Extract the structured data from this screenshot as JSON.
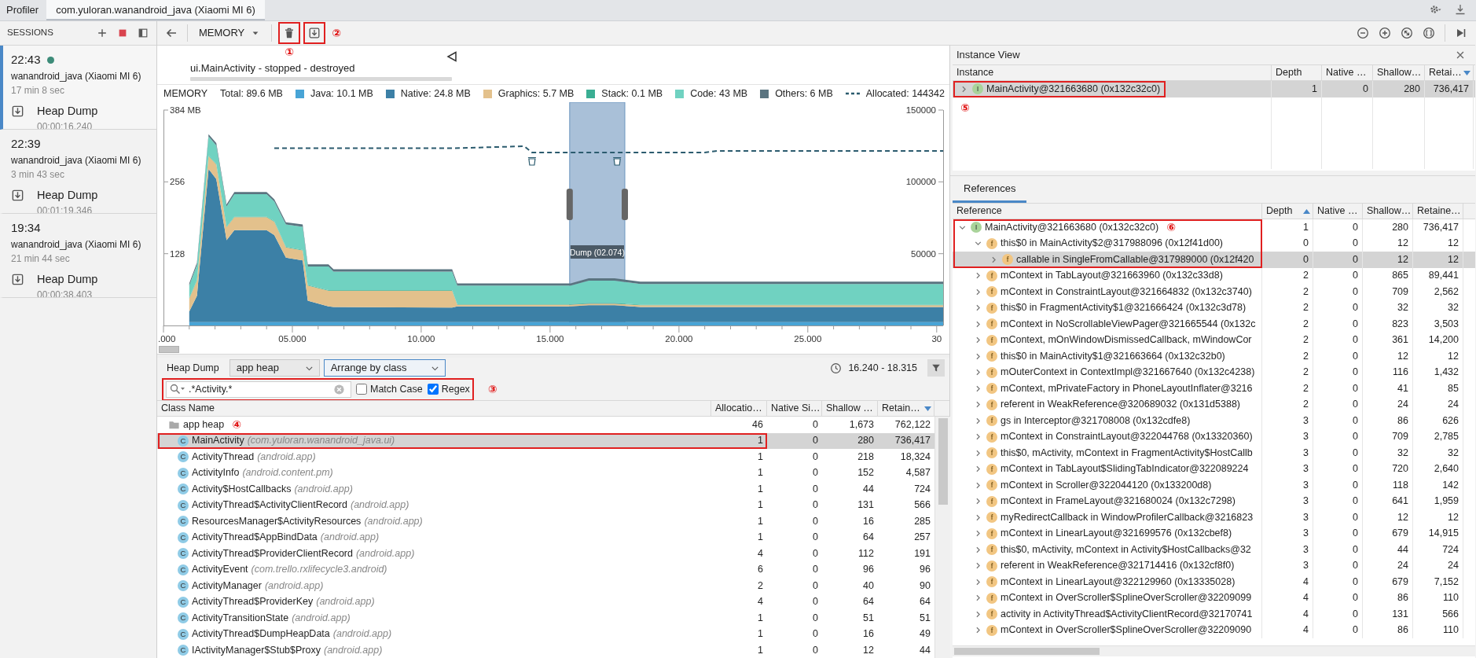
{
  "app_bar": {
    "title": "Profiler",
    "tabs": [
      {
        "label": "com.yuloran.wanandroid_java (Xiaomi MI 6)",
        "selected": true
      }
    ]
  },
  "sessions": {
    "title": "SESSIONS",
    "items": [
      {
        "time": "22:43",
        "live": true,
        "selected": true,
        "device": "wanandroid_java (Xiaomi MI 6)",
        "duration": "17 min 8 sec",
        "artifacts": [
          {
            "label": "Heap Dump",
            "time": "00:00:16.240"
          }
        ]
      },
      {
        "time": "22:39",
        "live": false,
        "selected": false,
        "device": "wanandroid_java (Xiaomi MI 6)",
        "duration": "3 min 43 sec",
        "artifacts": [
          {
            "label": "Heap Dump",
            "time": "00:01:19.346"
          }
        ]
      },
      {
        "time": "19:34",
        "live": false,
        "selected": false,
        "device": "wanandroid_java (Xiaomi MI 6)",
        "duration": "21 min 44 sec",
        "artifacts": [
          {
            "label": "Heap Dump",
            "time": "00:00:38.403"
          }
        ]
      }
    ]
  },
  "toolbar": {
    "profiler": "MEMORY",
    "actions": [
      {
        "kind": "delete",
        "highlighted": true,
        "note": "①"
      },
      {
        "kind": "export",
        "highlighted": true,
        "note": "②"
      }
    ]
  },
  "memory": {
    "event": {
      "label": "ui.MainActivity - stopped - destroyed"
    },
    "legend_title": "MEMORY",
    "total": "Total: 89.6 MB",
    "selection": {
      "label": "Dump (02.074)"
    },
    "chart_data": {
      "type": "area",
      "stacked": true,
      "xlim": [
        0,
        30.25
      ],
      "ylim": [
        0,
        384
      ],
      "x": [
        1.0,
        1.3,
        1.75,
        2.05,
        2.45,
        2.75,
        4.0,
        4.3,
        4.75,
        5.4,
        5.6,
        6.4,
        6.6,
        11.2,
        11.4,
        15.8,
        16.5,
        17.5,
        18.5,
        30.25
      ],
      "xticks": [
        {
          "value": 0,
          "label": ".000"
        },
        {
          "value": 5,
          "label": "05.000"
        },
        {
          "value": 10,
          "label": "10.000"
        },
        {
          "value": 15,
          "label": "15.000"
        },
        {
          "value": 20,
          "label": "20.000"
        },
        {
          "value": 25,
          "label": "25.000"
        },
        {
          "value": 30,
          "label": "30"
        }
      ],
      "yticks": [
        {
          "value": 128,
          "label": "128"
        },
        {
          "value": 256,
          "label": "256"
        },
        {
          "value": 384,
          "label": "384 MB"
        }
      ],
      "series": [
        {
          "name": "Java: 10.1 MB",
          "color": "#48a4d6",
          "values": [
            6,
            6,
            6,
            6,
            6,
            6,
            6,
            6,
            6,
            6,
            6,
            6,
            6,
            6,
            6,
            6,
            6,
            6,
            6,
            6
          ]
        },
        {
          "name": "Native: 24.8 MB",
          "color": "#3c80a6",
          "values": [
            19,
            47,
            273,
            255,
            146,
            164,
            164,
            155,
            115,
            110,
            38,
            28,
            27,
            26,
            28,
            28,
            30,
            30,
            27,
            27
          ]
        },
        {
          "name": "Graphics: 5.7 MB",
          "color": "#e3c18c",
          "values": [
            23,
            27,
            23,
            26,
            23,
            23,
            23,
            24,
            18,
            18,
            27,
            28,
            29,
            30,
            3,
            3,
            3,
            3,
            3,
            3
          ]
        },
        {
          "name": "Stack: 0.1 MB",
          "color": "#3aae93",
          "values": [
            1,
            1,
            1,
            1,
            1,
            1,
            1,
            1,
            1,
            1,
            1,
            1,
            1,
            1,
            1,
            1,
            1,
            1,
            1,
            1
          ]
        },
        {
          "name": "Code: 43 MB",
          "color": "#70d2c1",
          "values": [
            22,
            27,
            34,
            33,
            36,
            40,
            40,
            35,
            40,
            41,
            33,
            42,
            33,
            33,
            33,
            33,
            40,
            40,
            37,
            37
          ]
        },
        {
          "name": "Others: 6 MB",
          "color": "#5a7480",
          "values": [
            4,
            4,
            4,
            4,
            4,
            4,
            4,
            4,
            4,
            4,
            4,
            4,
            4,
            4,
            4,
            4,
            4,
            4,
            4,
            4
          ]
        }
      ]
    },
    "allocations": {
      "chart_data": {
        "type": "line",
        "xlim": [
          0,
          30.25
        ],
        "ylim": [
          0,
          150000
        ],
        "x": [
          4.3,
          11.2,
          14.0,
          14.3,
          21.0,
          21.5,
          30.25
        ],
        "yticks": [
          50000,
          100000,
          150000
        ],
        "series": [
          {
            "name": "Allocated: 144342",
            "color": "#2b5b6e",
            "line_style": "dashed",
            "values": [
              123400,
              123400,
              124800,
              120500,
              120500,
              121600,
              121600
            ]
          }
        ]
      }
    }
  },
  "heap_dump": {
    "title": "Heap Dump",
    "heap": {
      "label": "app heap",
      "focused": false
    },
    "arrangement": {
      "label": "Arrange by class",
      "focused": true
    },
    "range": "16.240 - 18.315",
    "filter": {
      "value": ".*Activity.*",
      "highlighted": true,
      "note": "③",
      "options": [
        {
          "label": "Match Case",
          "checked": false
        },
        {
          "label": "Regex",
          "checked": true
        }
      ]
    },
    "columns": [
      {
        "label": "Class Name",
        "sorted": false
      },
      {
        "label": "Allocatio…",
        "sorted": false
      },
      {
        "label": "Native Si…",
        "sorted": false
      },
      {
        "label": "Shallow …",
        "sorted": false
      },
      {
        "label": "Retain…",
        "sorted": true,
        "ascending": false
      }
    ],
    "rows": [
      {
        "kind": "group",
        "note": "④",
        "selected": false,
        "highlighted": false,
        "cells": [
          "app heap",
          "46",
          "0",
          "1,673",
          "762,122"
        ],
        "children": [
          {
            "kind": "class",
            "badge": "C",
            "package": "(com.yuloran.wanandroid_java.ui)",
            "selected": true,
            "highlighted": true,
            "cells": [
              "MainActivity",
              "1",
              "0",
              "280",
              "736,417"
            ]
          },
          {
            "kind": "class",
            "badge": "C",
            "package": "(android.app)",
            "selected": false,
            "highlighted": false,
            "cells": [
              "ActivityThread",
              "1",
              "0",
              "218",
              "18,324"
            ]
          },
          {
            "kind": "class",
            "badge": "C",
            "package": "(android.content.pm)",
            "selected": false,
            "highlighted": false,
            "cells": [
              "ActivityInfo",
              "1",
              "0",
              "152",
              "4,587"
            ]
          },
          {
            "kind": "class",
            "badge": "C",
            "package": "(android.app)",
            "selected": false,
            "highlighted": false,
            "cells": [
              "Activity$HostCallbacks",
              "1",
              "0",
              "44",
              "724"
            ]
          },
          {
            "kind": "class",
            "badge": "C",
            "package": "(android.app)",
            "selected": false,
            "highlighted": false,
            "cells": [
              "ActivityThread$ActivityClientRecord",
              "1",
              "0",
              "131",
              "566"
            ]
          },
          {
            "kind": "class",
            "badge": "C",
            "package": "(android.app)",
            "selected": false,
            "highlighted": false,
            "cells": [
              "ResourcesManager$ActivityResources",
              "1",
              "0",
              "16",
              "285"
            ]
          },
          {
            "kind": "class",
            "badge": "C",
            "package": "(android.app)",
            "selected": false,
            "highlighted": false,
            "cells": [
              "ActivityThread$AppBindData",
              "1",
              "0",
              "64",
              "257"
            ]
          },
          {
            "kind": "class",
            "badge": "C",
            "package": "(android.app)",
            "selected": false,
            "highlighted": false,
            "cells": [
              "ActivityThread$ProviderClientRecord",
              "4",
              "0",
              "112",
              "191"
            ]
          },
          {
            "kind": "class",
            "badge": "C",
            "package": "(com.trello.rxlifecycle3.android)",
            "selected": false,
            "highlighted": false,
            "cells": [
              "ActivityEvent",
              "6",
              "0",
              "96",
              "96"
            ]
          },
          {
            "kind": "class",
            "badge": "C",
            "package": "(android.app)",
            "selected": false,
            "highlighted": false,
            "cells": [
              "ActivityManager",
              "2",
              "0",
              "40",
              "90"
            ]
          },
          {
            "kind": "class",
            "badge": "C",
            "package": "(android.app)",
            "selected": false,
            "highlighted": false,
            "cells": [
              "ActivityThread$ProviderKey",
              "4",
              "0",
              "64",
              "64"
            ]
          },
          {
            "kind": "class",
            "badge": "C",
            "package": "(android.app)",
            "selected": false,
            "highlighted": false,
            "cells": [
              "ActivityTransitionState",
              "1",
              "0",
              "51",
              "51"
            ]
          },
          {
            "kind": "class",
            "badge": "C",
            "package": "(android.app)",
            "selected": false,
            "highlighted": false,
            "cells": [
              "ActivityThread$DumpHeapData",
              "1",
              "0",
              "16",
              "49"
            ]
          },
          {
            "kind": "class",
            "badge": "C",
            "package": "(android.app)",
            "selected": false,
            "highlighted": false,
            "cells": [
              "IActivityManager$Stub$Proxy",
              "1",
              "0",
              "12",
              "44"
            ]
          }
        ]
      }
    ]
  },
  "instance_view": {
    "title": "Instance View",
    "note": "⑤",
    "columns": [
      {
        "label": "Instance",
        "sorted": false
      },
      {
        "label": "Depth",
        "sorted": false
      },
      {
        "label": "Native …",
        "sorted": false
      },
      {
        "label": "Shallow…",
        "sorted": false
      },
      {
        "label": "Retai…",
        "sorted": true,
        "ascending": false
      }
    ],
    "rows": [
      {
        "kind": "instance",
        "badge": "I",
        "expanded": false,
        "selected": true,
        "highlighted": true,
        "cells": [
          "MainActivity@321663680 (0x132c32c0)",
          "1",
          "0",
          "280",
          "736,417"
        ]
      }
    ]
  },
  "references": {
    "tabs": [
      {
        "label": "References",
        "selected": true
      }
    ],
    "columns": [
      {
        "label": "Reference",
        "sorted": false
      },
      {
        "label": "Depth",
        "sorted": true,
        "ascending": true
      },
      {
        "label": "Native …",
        "sorted": false
      },
      {
        "label": "Shallow…",
        "sorted": false
      },
      {
        "label": "Retaine…",
        "sorted": false
      }
    ],
    "rows": [
      {
        "kind": "instance",
        "badge": "I",
        "note": "⑥",
        "expanded": true,
        "selected": false,
        "highlighted": true,
        "cells": [
          "MainActivity@321663680 (0x132c32c0)",
          "1",
          "0",
          "280",
          "736,417"
        ],
        "children": [
          {
            "kind": "field",
            "badge": "f",
            "expanded": true,
            "selected": false,
            "highlighted": true,
            "cells": [
              "this$0 in MainActivity$2@317988096 (0x12f41d00)",
              "0",
              "0",
              "12",
              "12"
            ],
            "children": [
              {
                "kind": "field",
                "badge": "f",
                "expanded": false,
                "selected": true,
                "highlighted": true,
                "cells": [
                  "callable in SingleFromCallable@317989000 (0x12f420",
                  "0",
                  "0",
                  "12",
                  "12"
                ]
              }
            ]
          },
          {
            "kind": "field",
            "badge": "f",
            "expanded": false,
            "selected": false,
            "highlighted": false,
            "cells": [
              "mContext in TabLayout@321663960 (0x132c33d8)",
              "2",
              "0",
              "865",
              "89,441"
            ]
          },
          {
            "kind": "field",
            "badge": "f",
            "expanded": false,
            "selected": false,
            "highlighted": false,
            "cells": [
              "mContext in ConstraintLayout@321664832 (0x132c3740)",
              "2",
              "0",
              "709",
              "2,562"
            ]
          },
          {
            "kind": "field",
            "badge": "f",
            "expanded": false,
            "selected": false,
            "highlighted": false,
            "cells": [
              "this$0 in FragmentActivity$1@321666424 (0x132c3d78)",
              "2",
              "0",
              "32",
              "32"
            ]
          },
          {
            "kind": "field",
            "badge": "f",
            "expanded": false,
            "selected": false,
            "highlighted": false,
            "cells": [
              "mContext in NoScrollableViewPager@321665544 (0x132c",
              "2",
              "0",
              "823",
              "3,503"
            ]
          },
          {
            "kind": "field",
            "badge": "f",
            "expanded": false,
            "selected": false,
            "highlighted": false,
            "cells": [
              "mContext, mOnWindowDismissedCallback, mWindowCor",
              "2",
              "0",
              "361",
              "14,200"
            ]
          },
          {
            "kind": "field",
            "badge": "f",
            "expanded": false,
            "selected": false,
            "highlighted": false,
            "cells": [
              "this$0 in MainActivity$1@321663664 (0x132c32b0)",
              "2",
              "0",
              "12",
              "12"
            ]
          },
          {
            "kind": "field",
            "badge": "f",
            "expanded": false,
            "selected": false,
            "highlighted": false,
            "cells": [
              "mOuterContext in ContextImpl@321667640 (0x132c4238)",
              "2",
              "0",
              "116",
              "1,432"
            ]
          },
          {
            "kind": "field",
            "badge": "f",
            "expanded": false,
            "selected": false,
            "highlighted": false,
            "cells": [
              "mContext, mPrivateFactory in PhoneLayoutInflater@3216",
              "2",
              "0",
              "41",
              "85"
            ]
          },
          {
            "kind": "field",
            "badge": "f",
            "expanded": false,
            "selected": false,
            "highlighted": false,
            "cells": [
              "referent in WeakReference@320689032 (0x131d5388)",
              "2",
              "0",
              "24",
              "24"
            ]
          },
          {
            "kind": "field",
            "badge": "f",
            "expanded": false,
            "selected": false,
            "highlighted": false,
            "cells": [
              "gs in Interceptor@321708008 (0x132cdfe8)",
              "3",
              "0",
              "86",
              "626"
            ]
          },
          {
            "kind": "field",
            "badge": "f",
            "expanded": false,
            "selected": false,
            "highlighted": false,
            "cells": [
              "mContext in ConstraintLayout@322044768 (0x13320360)",
              "3",
              "0",
              "709",
              "2,785"
            ]
          },
          {
            "kind": "field",
            "badge": "f",
            "expanded": false,
            "selected": false,
            "highlighted": false,
            "cells": [
              "this$0, mActivity, mContext in FragmentActivity$HostCallb",
              "3",
              "0",
              "32",
              "32"
            ]
          },
          {
            "kind": "field",
            "badge": "f",
            "expanded": false,
            "selected": false,
            "highlighted": false,
            "cells": [
              "mContext in TabLayout$SlidingTabIndicator@322089224",
              "3",
              "0",
              "720",
              "2,640"
            ]
          },
          {
            "kind": "field",
            "badge": "f",
            "expanded": false,
            "selected": false,
            "highlighted": false,
            "cells": [
              "mContext in Scroller@322044120 (0x133200d8)",
              "3",
              "0",
              "118",
              "142"
            ]
          },
          {
            "kind": "field",
            "badge": "f",
            "expanded": false,
            "selected": false,
            "highlighted": false,
            "cells": [
              "mContext in FrameLayout@321680024 (0x132c7298)",
              "3",
              "0",
              "641",
              "1,959"
            ]
          },
          {
            "kind": "field",
            "badge": "f",
            "expanded": false,
            "selected": false,
            "highlighted": false,
            "cells": [
              "myRedirectCallback in WindowProfilerCallback@3216823",
              "3",
              "0",
              "12",
              "12"
            ]
          },
          {
            "kind": "field",
            "badge": "f",
            "expanded": false,
            "selected": false,
            "highlighted": false,
            "cells": [
              "mContext in LinearLayout@321699576 (0x132cbef8)",
              "3",
              "0",
              "679",
              "14,915"
            ]
          },
          {
            "kind": "field",
            "badge": "f",
            "expanded": false,
            "selected": false,
            "highlighted": false,
            "cells": [
              "this$0, mActivity, mContext in Activity$HostCallbacks@32",
              "3",
              "0",
              "44",
              "724"
            ]
          },
          {
            "kind": "field",
            "badge": "f",
            "expanded": false,
            "selected": false,
            "highlighted": false,
            "cells": [
              "referent in WeakReference@321714416 (0x132cf8f0)",
              "3",
              "0",
              "24",
              "24"
            ]
          },
          {
            "kind": "field",
            "badge": "f",
            "expanded": false,
            "selected": false,
            "highlighted": false,
            "cells": [
              "mContext in LinearLayout@322129960 (0x13335028)",
              "4",
              "0",
              "679",
              "7,152"
            ]
          },
          {
            "kind": "field",
            "badge": "f",
            "expanded": false,
            "selected": false,
            "highlighted": false,
            "cells": [
              "mContext in OverScroller$SplineOverScroller@32209099",
              "4",
              "0",
              "86",
              "110"
            ]
          },
          {
            "kind": "field",
            "badge": "f",
            "expanded": false,
            "selected": false,
            "highlighted": false,
            "cells": [
              "activity in ActivityThread$ActivityClientRecord@32170741",
              "4",
              "0",
              "131",
              "566"
            ]
          },
          {
            "kind": "field",
            "badge": "f",
            "expanded": false,
            "selected": false,
            "highlighted": false,
            "cells": [
              "mContext in OverScroller$SplineOverScroller@32209090",
              "4",
              "0",
              "86",
              "110"
            ]
          }
        ]
      }
    ]
  }
}
